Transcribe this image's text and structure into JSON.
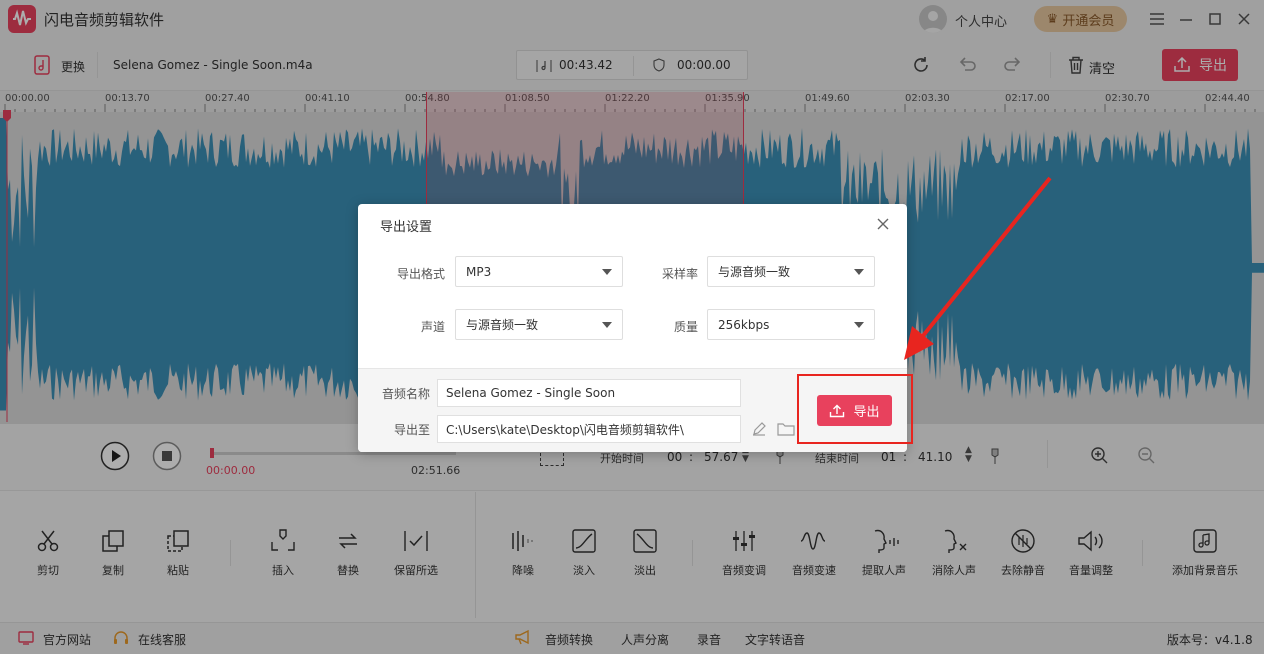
{
  "app": {
    "title": "闪电音频剪辑软件",
    "user_center": "个人中心",
    "vip": "开通会员"
  },
  "toolbar": {
    "replace": "更换",
    "filename": "Selena Gomez - Single Soon.m4a",
    "current_time": "00:43.42",
    "duration_time": "00:00.00",
    "clear": "清空",
    "export": "导出"
  },
  "ruler": {
    "ticks": [
      "00:00.00",
      "00:13.70",
      "00:27.40",
      "00:41.10",
      "00:54.80",
      "01:08.50",
      "01:22.20",
      "01:35.90",
      "01:49.60",
      "02:03.30",
      "02:17.00",
      "02:30.70",
      "02:44.40"
    ]
  },
  "player": {
    "pos": "00:00.00",
    "total": "02:51.66",
    "start_label": "开始时间",
    "start_min": "00",
    "start_sec": "57.67",
    "end_label": "结束时间",
    "end_min": "01",
    "end_sec": "41.10"
  },
  "tools": [
    "剪切",
    "复制",
    "粘贴",
    "插入",
    "替换",
    "保留所选",
    "降噪",
    "淡入",
    "淡出",
    "音频变调",
    "音频变速",
    "提取人声",
    "消除人声",
    "去除静音",
    "音量调整",
    "添加背景音乐"
  ],
  "footer": {
    "website": "官方网站",
    "service": "在线客服",
    "links": [
      "音频转换",
      "人声分离",
      "录音",
      "文字转语音"
    ],
    "version": "版本号：v4.1.8"
  },
  "dialog": {
    "title": "导出设置",
    "format_label": "导出格式",
    "format_value": "MP3",
    "rate_label": "采样率",
    "rate_value": "与源音频一致",
    "channel_label": "声道",
    "channel_value": "与源音频一致",
    "quality_label": "质量",
    "quality_value": "256kbps",
    "name_label": "音频名称",
    "name_value": "Selena Gomez - Single Soon",
    "path_label": "导出至",
    "path_value": "C:\\Users\\kate\\Desktop\\闪电音频剪辑软件\\",
    "export": "导出"
  },
  "colors": {
    "accent": "#e8415d",
    "wave": "#3c8fb5",
    "annotation": "#e8251f"
  }
}
